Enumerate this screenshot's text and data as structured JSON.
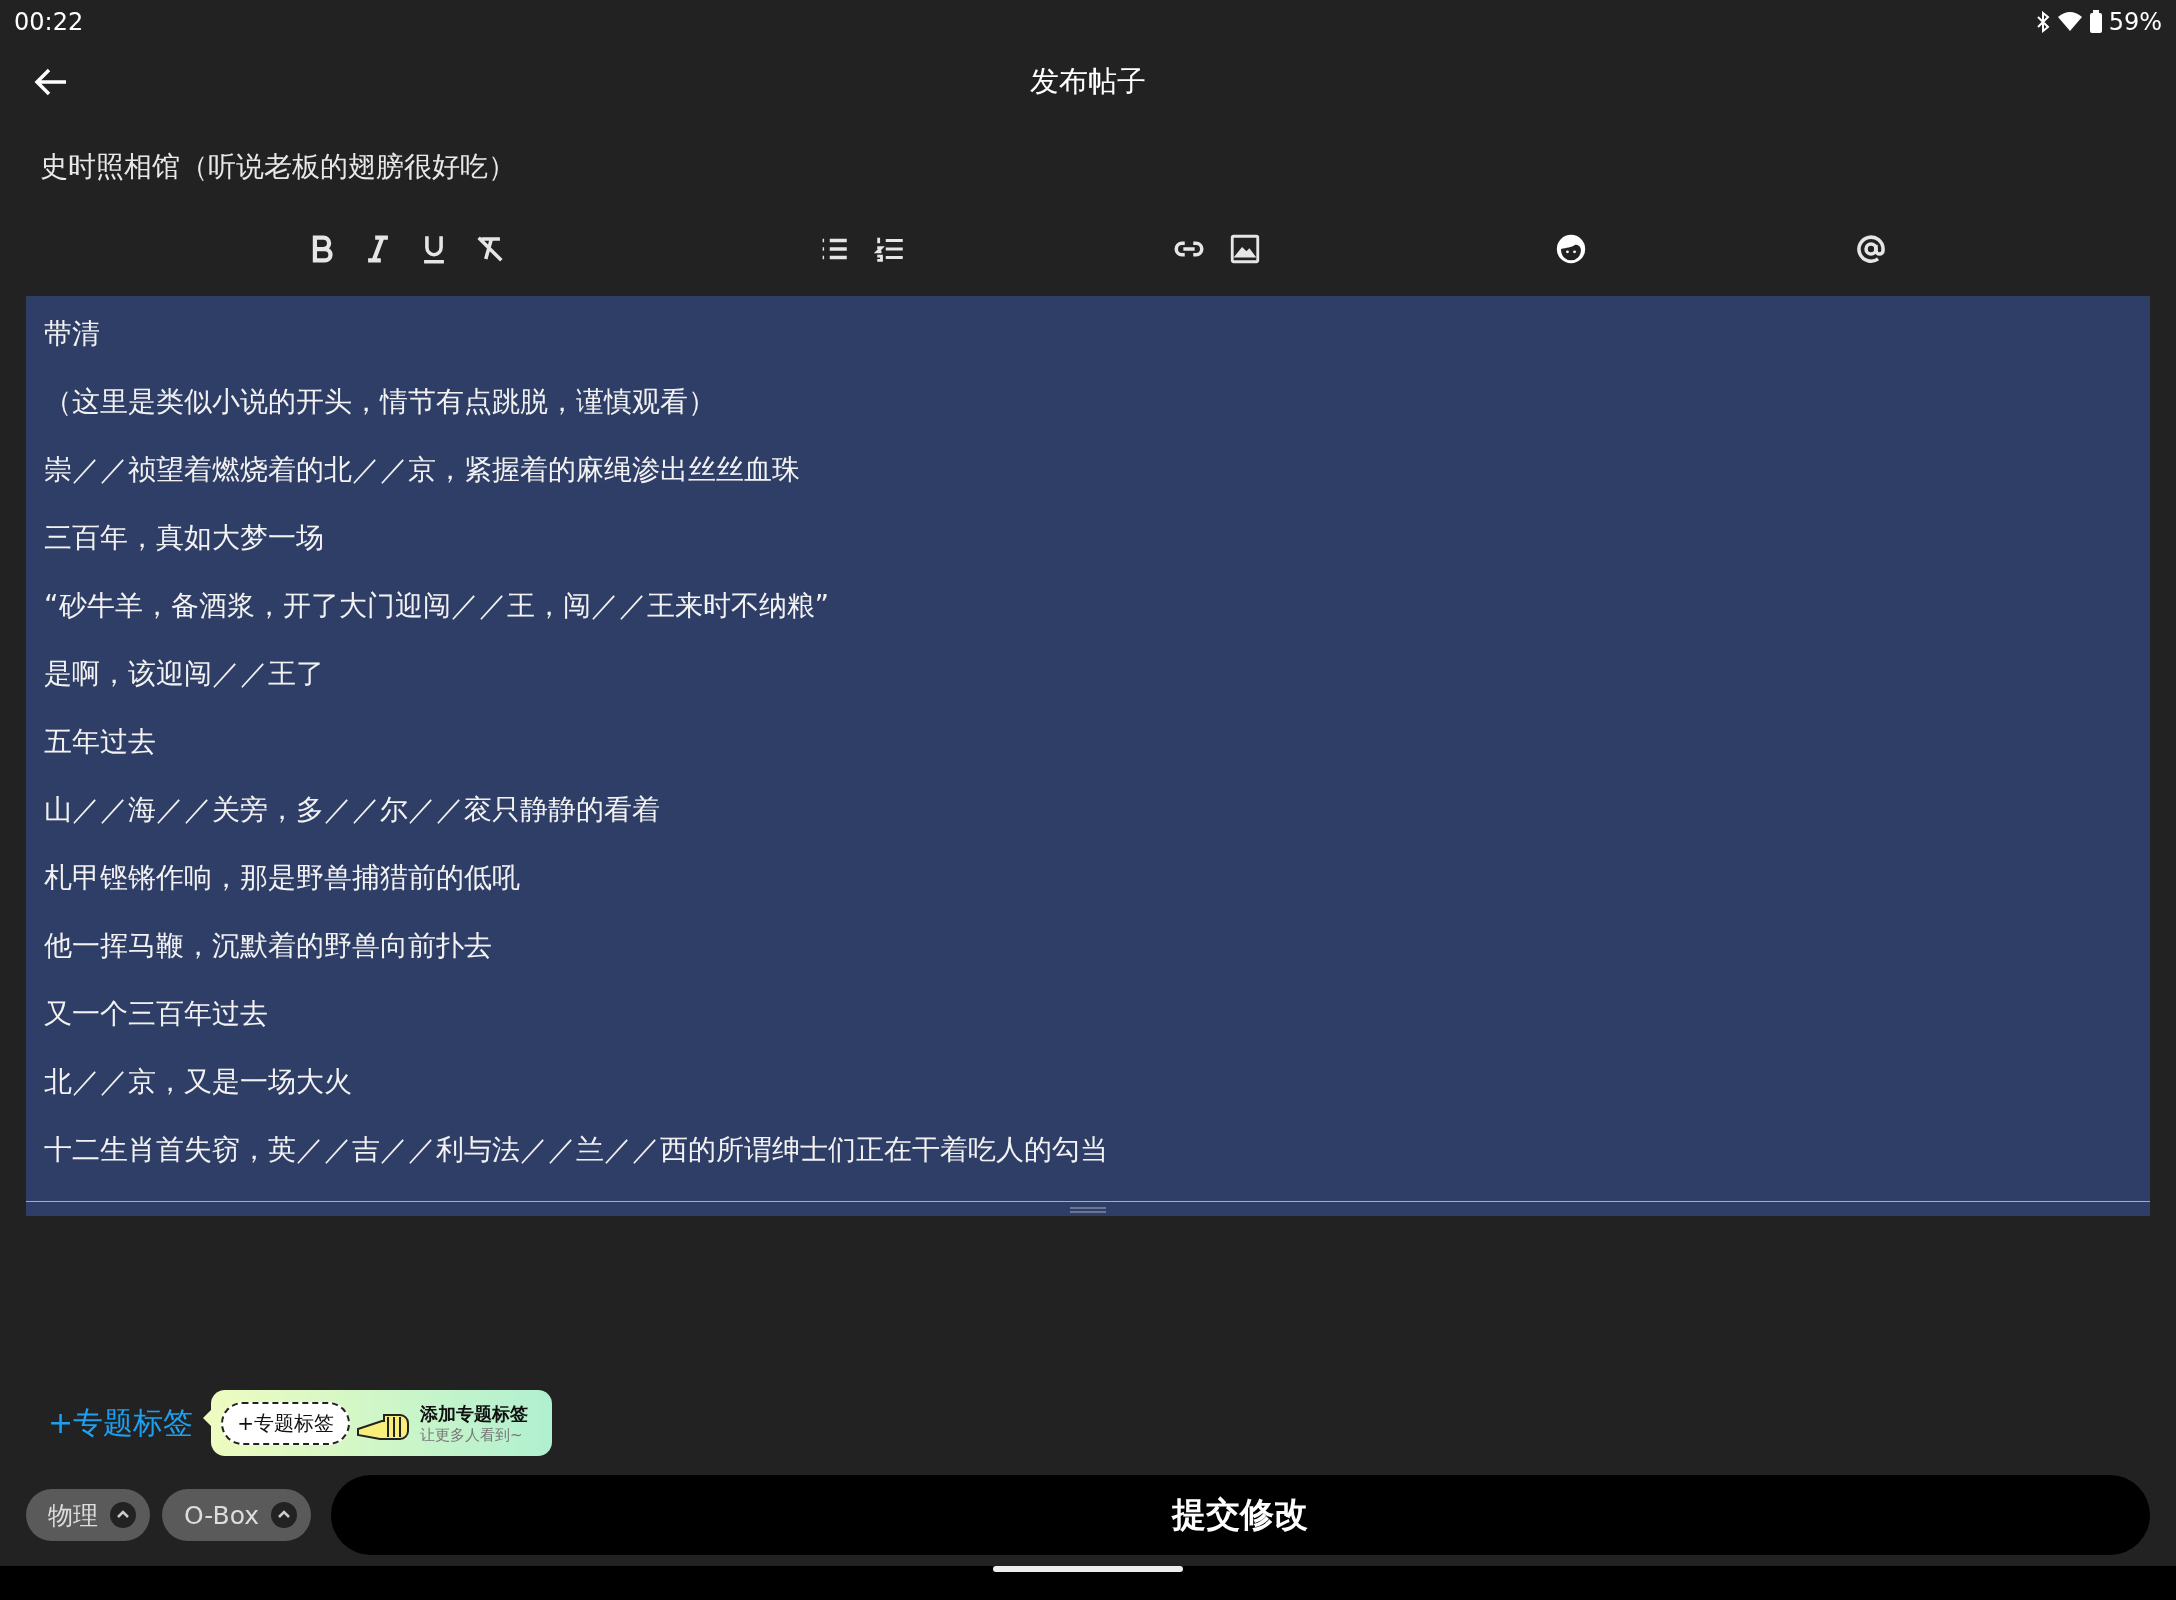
{
  "status_bar": {
    "time": "00:22",
    "battery": "59%"
  },
  "header": {
    "title": "发布帖子"
  },
  "post_title": "史时照相馆（听说老板的翅膀很好吃）",
  "editor": {
    "lines": [
      "带清",
      "（这里是类似小说的开头，情节有点跳脱，谨慎观看）",
      "崇／／祯望着燃烧着的北／／京，紧握着的麻绳渗出丝丝血珠",
      "三百年，真如大梦一场",
      "“砂牛羊，备酒浆，开了大门迎闯／／王，闯／／王来时不纳粮”",
      "是啊，该迎闯／／王了",
      "五年过去",
      "山／／海／／关旁，多／／尔／／衮只静静的看着",
      "札甲铿锵作响，那是野兽捕猎前的低吼",
      "他一挥马鞭，沉默着的野兽向前扑去",
      "又一个三百年过去",
      "北／／京，又是一场大火",
      "十二生肖首失窃，英／／吉／／利与法／／兰／／西的所谓绅士们正在干着吃人的勾当"
    ]
  },
  "topic_link": "+专题标签",
  "tooltip": {
    "tag": "+专题标签",
    "title": "添加专题标签",
    "subtitle": "让更多人看到~"
  },
  "tags": [
    {
      "label": "物理"
    },
    {
      "label": "O-Box"
    }
  ],
  "submit_button": "提交修改"
}
